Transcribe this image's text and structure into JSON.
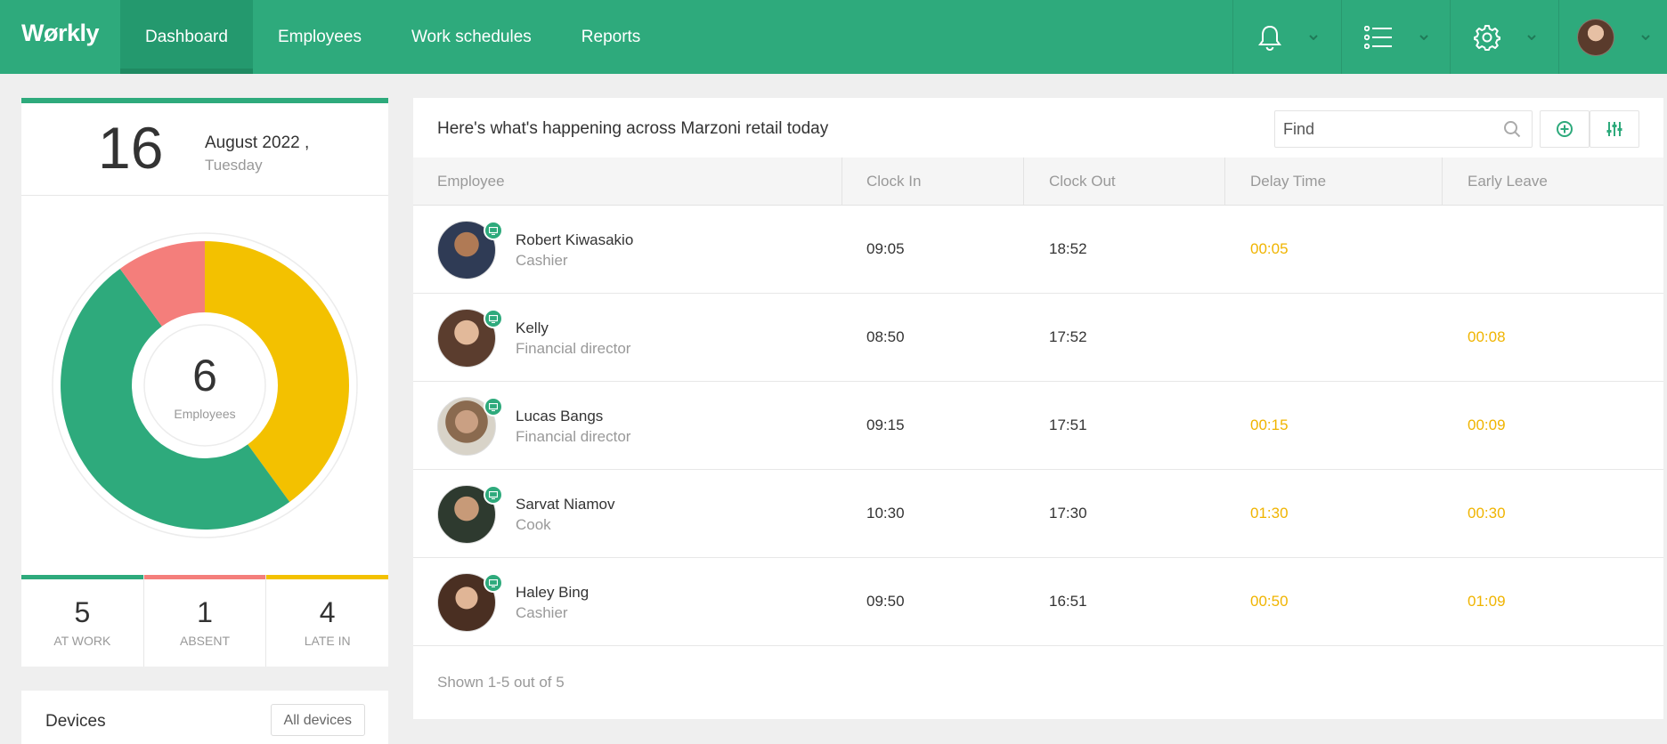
{
  "app": {
    "logo": "Wørkly"
  },
  "nav": [
    {
      "label": "Dashboard",
      "active": true
    },
    {
      "label": "Employees",
      "active": false
    },
    {
      "label": "Work schedules",
      "active": false
    },
    {
      "label": "Reports",
      "active": false
    }
  ],
  "topbar_icons": [
    "bell-icon",
    "list-icon",
    "gear-icon",
    "avatar"
  ],
  "date_card": {
    "day": "16",
    "month_year": "August 2022 ,",
    "weekday": "Tuesday"
  },
  "donut": {
    "total": "6",
    "label": "Employees",
    "segments": [
      {
        "name": "at-work",
        "value": 5,
        "color": "#2eaa7c"
      },
      {
        "name": "absent",
        "value": 1,
        "color": "#f47e7b"
      },
      {
        "name": "late-in",
        "value": 4,
        "color": "#f3c100"
      }
    ]
  },
  "stats": [
    {
      "value": "5",
      "label": "AT WORK",
      "color": "#2eaa7c"
    },
    {
      "value": "1",
      "label": "ABSENT",
      "color": "#f47e7b"
    },
    {
      "value": "4",
      "label": "LATE IN",
      "color": "#f3c100"
    }
  ],
  "devices": {
    "title": "Devices",
    "button": "All devices"
  },
  "main": {
    "title": "Here's what's happening across Marzoni retail today",
    "search_placeholder": "Find",
    "columns": [
      "Employee",
      "Clock In",
      "Clock Out",
      "Delay Time",
      "Early Leave"
    ],
    "rows": [
      {
        "name": "Robert Kiwasakio",
        "role": "Cashier",
        "clock_in": "09:05",
        "clock_out": "18:52",
        "delay": "00:05",
        "early": ""
      },
      {
        "name": "Kelly",
        "role": "Financial director",
        "clock_in": "08:50",
        "clock_out": "17:52",
        "delay": "",
        "early": "00:08"
      },
      {
        "name": "Lucas Bangs",
        "role": "Financial director",
        "clock_in": "09:15",
        "clock_out": "17:51",
        "delay": "00:15",
        "early": "00:09"
      },
      {
        "name": "Sarvat Niamov",
        "role": "Cook",
        "clock_in": "10:30",
        "clock_out": "17:30",
        "delay": "01:30",
        "early": "00:30"
      },
      {
        "name": "Haley Bing",
        "role": "Cashier",
        "clock_in": "09:50",
        "clock_out": "16:51",
        "delay": "00:50",
        "early": "01:09"
      }
    ],
    "footer": "Shown 1-5 out of 5"
  },
  "colors": {
    "brand": "#2eaa7c",
    "warn": "#f0b400"
  }
}
